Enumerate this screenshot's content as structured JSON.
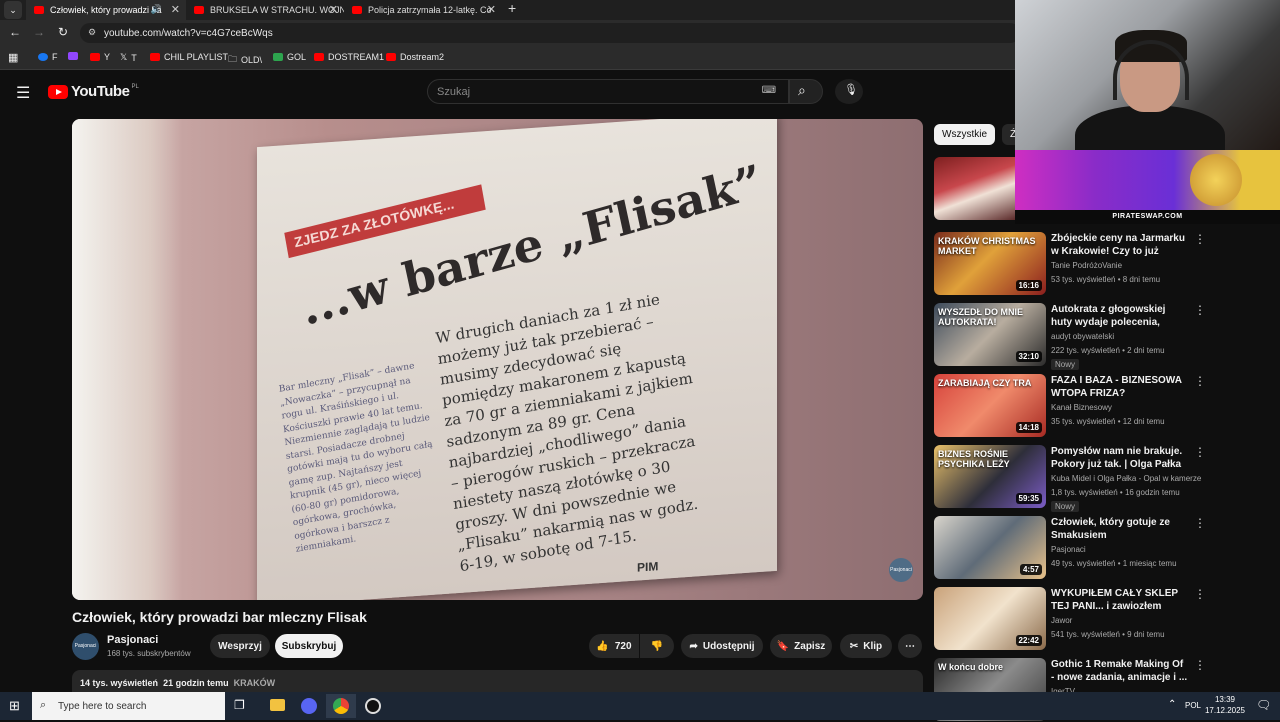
{
  "browser": {
    "tabs": [
      {
        "title": "Człowiek, który prowadzi ba",
        "active": true
      },
      {
        "title": "BRUKSELA W STRACHU. WOJN",
        "active": false
      },
      {
        "title": "Policja zatrzymała 12-latkę. Co",
        "active": false
      }
    ],
    "new_tab": "+",
    "url": "youtube.com/watch?v=c4G7ceBcWqs",
    "bookmarks": [
      "F",
      "",
      "Y",
      "T",
      "CHIL PLAYLIST",
      "OLD\\",
      "GOL",
      "DOSTREAM1",
      "Dostream2"
    ]
  },
  "yt": {
    "logo_word": "YouTube",
    "logo_country": "PL",
    "search_placeholder": "Szukaj",
    "video": {
      "title": "Człowiek, który prowadzi bar mleczny Flisak",
      "channel": "Pasjonaci",
      "channel_avatar_text": "Pasjonaci",
      "subscribers": "168 tys. subskrybentów",
      "support_label": "Wesprzyj",
      "subscribe_label": "Subskrybuj",
      "likes": "720",
      "share_label": "Udostępnij",
      "save_label": "Zapisz",
      "clip_label": "Klip",
      "views": "14 tys. wyświetleń",
      "age": "21 godzin temu",
      "tag": "KRAKÓW",
      "frame": {
        "banner": "ZJEDZ ZA ZŁOTÓWKĘ...",
        "headline": "...w barze „Flisak”",
        "body": "W drugich daniach za 1 zł nie możemy już tak przebierać – musimy zdecydować się pomiędzy makaronem z kapustą za 70 gr a ziemniakami z jajkiem sadzonym za 89 gr. Cena najbardziej „chodliwego” dania – pierogów ruskich – przekracza niestety naszą złotówkę o 30 groszy. W dni powszednie we „Flisaku” nakarmią nas w godz. 6-19, w sobotę od 7-15.",
        "side": "Bar mleczny „Flisak” – dawne „Nowaczka” – przycupnął na rogu ul. Kraśińskiego i ul. Kościuszki prawie 40 lat temu. Niezmiennie zaglądają tu ludzie starsi. Posiadacze drobnej gotówki mają tu do wyboru całą gamę zup. Najtańszy jest krupnik (45 gr), nieco więcej (60-80 gr) pomidorowa, ogórkowa, grochówka, ogórkowa i barszcz z ziemniakami.",
        "signature": "PIM"
      }
    },
    "chips": [
      "Wszystkie",
      "Ź"
    ],
    "overlay_site": "PIRATESWAP.COM",
    "recommendations": [
      {
        "title": "Zbójeckie ceny na Jarmarku w Krakowie! Czy to już przesada?",
        "channel": "Tanie PodróżoVanie",
        "meta": "53 tys. wyświetleń • 8 dni temu",
        "duration": "16:16",
        "badge": "",
        "thumb": "linear-gradient(135deg,#7a2b1c,#e0a13a 45%,#8b1e1e)",
        "thumb_text": "KRAKÓW CHRISTMAS MARKET"
      },
      {
        "title": "Autokrata z głogowskiej huty wydaje polecenia, podnosi gło...",
        "channel": "audyt obywatelski",
        "meta": "222 tys. wyświetleń • 2 dni temu",
        "duration": "32:10",
        "badge": "Nowy",
        "thumb": "linear-gradient(135deg,#3c4a5a,#b8ad9f 50%,#2b2b2b)",
        "thumb_text": "WYSZEDŁ DO MNIE AUTOKRATA!"
      },
      {
        "title": "FAZA I BAZA - BIZNESOWA WTOPA FRIZA?",
        "channel": "Kanał Biznesowy",
        "meta": "35 tys. wyświetleń • 12 dni temu",
        "duration": "14:18",
        "badge": "",
        "thumb": "linear-gradient(135deg,#d6423b,#f08a6b 50%,#a72a23)",
        "thumb_text": "ZARABIAJĄ CZY TRA"
      },
      {
        "title": "Pomysłów nam nie brakuje. Pokory już tak. | Olga Pałka",
        "channel": "Kuba Midel i Olga Pałka - Opal w kamerze",
        "meta": "1,8 tys. wyświetleń • 16 godzin temu",
        "duration": "59:35",
        "badge": "Nowy",
        "thumb": "linear-gradient(135deg,#e9c16a,#2e2e3a 55%,#7b5cc6)",
        "thumb_text": "BIZNES ROŚNIE PSYCHIKA LEŻY"
      },
      {
        "title": "Człowiek, który gotuje ze Smakusiem",
        "channel": "Pasjonaci",
        "meta": "49 tys. wyświetleń • 1 miesiąc temu",
        "duration": "4:57",
        "badge": "",
        "thumb": "linear-gradient(135deg,#d9d5cc,#5f6b78 50%,#e8c28a)",
        "thumb_text": ""
      },
      {
        "title": "WYKUPIŁEM CAŁY SKLEP TEJ PANI... i zawiozłem wszystko ...",
        "channel": "Jawor",
        "meta": "541 tys. wyświetleń • 9 dni temu",
        "duration": "22:42",
        "badge": "",
        "thumb": "linear-gradient(135deg,#c9a27a,#f1e2cc 50%,#8a6a4a)",
        "thumb_text": ""
      },
      {
        "title": "Gothic 1 Remake Making Of - nowe zadania, animacje i ...",
        "channel": "IgerTV",
        "meta": "",
        "duration": "",
        "badge": "",
        "thumb": "linear-gradient(135deg,#2a2a2a,#8b8b8b 50%,#3b3b3b)",
        "thumb_text": "W końcu dobre"
      }
    ]
  },
  "taskbar": {
    "search_placeholder": "Type here to search",
    "lang": "POL",
    "time": "13:39",
    "date": "17.12.2025"
  }
}
